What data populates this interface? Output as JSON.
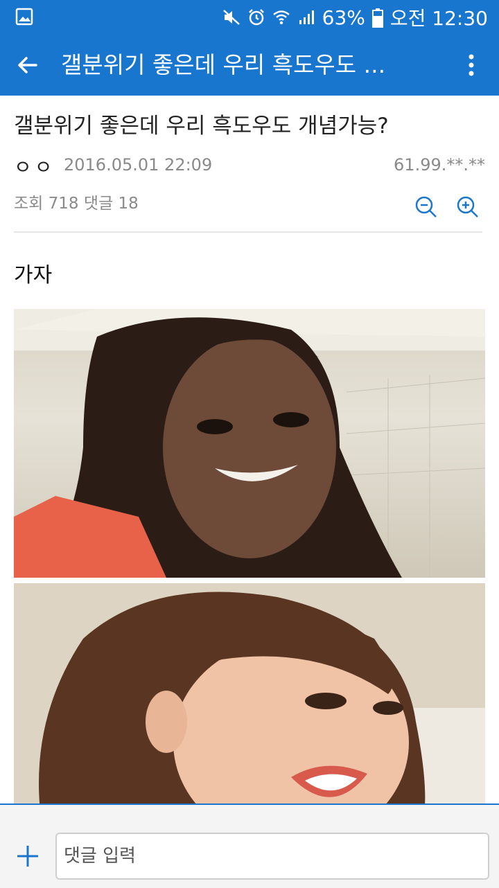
{
  "status_bar": {
    "battery": "63%",
    "time": "오전 12:30",
    "icons": [
      "gallery-icon",
      "mute-icon",
      "alarm-icon",
      "wifi-icon",
      "signal-icon",
      "battery-icon"
    ]
  },
  "app_bar": {
    "title": "갤분위기 좋은데 우리 흑도우도 ...",
    "back_icon": "back-arrow-icon",
    "more_icon": "more-vert-icon"
  },
  "post": {
    "title": "갤분위기 좋은데 우리 흑도우도 개념가능?",
    "author": "ㅇㅇ",
    "date": "2016.05.01 22:09",
    "ip": "61.99.**.**",
    "stats": "조회 718 댓글 18",
    "body_text": "가자",
    "images": [
      "photo",
      "photo"
    ]
  },
  "bottom_bar": {
    "add_icon": "plus-icon",
    "comment_placeholder": "댓글 입력"
  },
  "colors": {
    "primary": "#1976cf",
    "muted_text": "#8a8a8a"
  }
}
